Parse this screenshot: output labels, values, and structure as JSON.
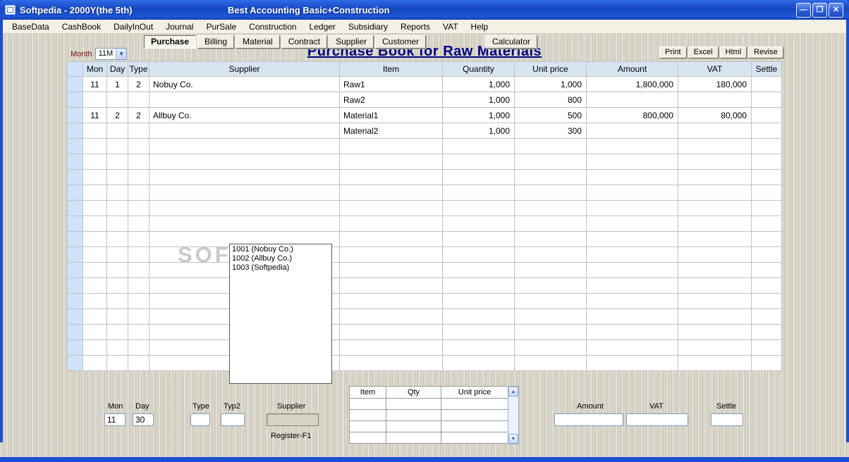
{
  "window": {
    "title": "Softpedia - 2000Y(the 5th)",
    "subtitle": "Best Accounting Basic+Construction",
    "controls": {
      "minimize": "—",
      "restore": "❐",
      "close": "✕"
    }
  },
  "menu": {
    "items": [
      "BaseData",
      "CashBook",
      "DailyInOut",
      "Journal",
      "PurSale",
      "Construction",
      "Ledger",
      "Subsidiary",
      "Reports",
      "VAT",
      "Help"
    ]
  },
  "toolbar": {
    "tabs": [
      {
        "label": "Purchase",
        "active": true
      },
      {
        "label": "Billing",
        "active": false
      },
      {
        "label": "Material",
        "active": false
      },
      {
        "label": "Contract",
        "active": false
      },
      {
        "label": "Supplier",
        "active": false
      },
      {
        "label": "Customer",
        "active": false
      }
    ],
    "calculator_label": "Calculator"
  },
  "filters": {
    "month_label": "Month",
    "month_value": "11M"
  },
  "page": {
    "title": "Purchase Book for Raw Materials"
  },
  "actions": {
    "print": "Print",
    "excel": "Excel",
    "html": "Html",
    "revise": "Revise"
  },
  "grid": {
    "headers": [
      "Mon",
      "Day",
      "Type",
      "Supplier",
      "Item",
      "Quantity",
      "Unit price",
      "Amount",
      "VAT",
      "Settle"
    ],
    "rows": [
      [
        "11",
        "1",
        "2",
        "Nobuy Co.",
        "Raw1",
        "1,000",
        "1,000",
        "1,800,000",
        "180,000",
        ""
      ],
      [
        "",
        "",
        "",
        "",
        "Raw2",
        "1,000",
        "800",
        "",
        "",
        ""
      ],
      [
        "11",
        "2",
        "2",
        "Allbuy Co.",
        "Material1",
        "1,000",
        "500",
        "800,000",
        "80,000",
        ""
      ],
      [
        "",
        "",
        "",
        "",
        "Material2",
        "1,000",
        "300",
        "",
        "",
        ""
      ]
    ],
    "empty_row_count": 15
  },
  "supplier_dropdown": {
    "items": [
      "1001 (Nobuy Co.)",
      "1002 (Allbuy Co.)",
      "1003 (Softpedia)"
    ]
  },
  "watermark": "SOFT",
  "entry_panel": {
    "mon_label": "Mon",
    "mon_value": "11",
    "day_label": "Day",
    "day_value": "30",
    "type_label": "Type",
    "type_value": "",
    "typ2_label": "Typ2",
    "typ2_value": "",
    "supplier_label": "Supplier",
    "register_label": "Register-F1",
    "item_grid": {
      "headers": [
        "Item",
        "Qty",
        "Unit price"
      ]
    },
    "amount_label": "Amount",
    "amount_value": "",
    "vat_label": "VAT",
    "vat_value": "",
    "settle_label": "Settle",
    "settle_value": ""
  },
  "icons": {
    "up_arrow": "▲",
    "down_arrow": "▼",
    "combo_arrow": "▼"
  },
  "colors": {
    "title_text": "#000080",
    "frame_blue": "#1c4fd0",
    "header_bg": "#d7e5f3",
    "accent_maroon": "#7b1010"
  }
}
